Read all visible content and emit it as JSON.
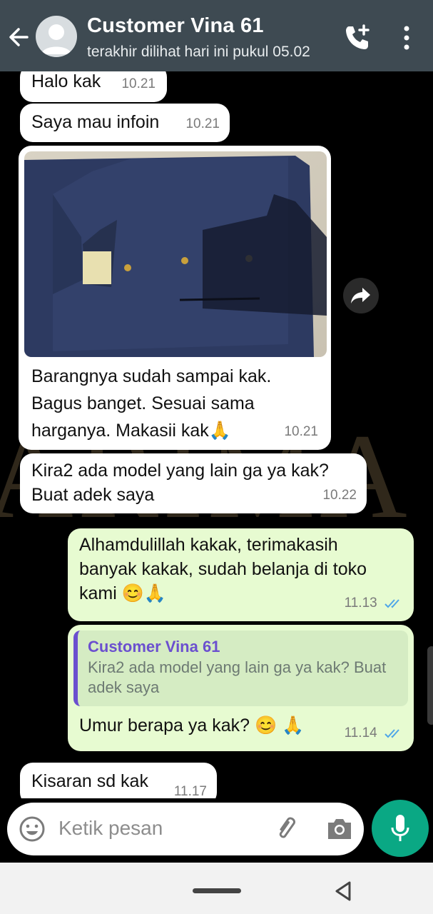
{
  "header": {
    "contact_name": "Customer Vina 61",
    "last_seen": "terakhir dilihat hari ini pukul 05.02"
  },
  "messages": [
    {
      "direction": "in",
      "text": "Halo kak",
      "time": "10.21"
    },
    {
      "direction": "in",
      "text": "Saya mau infoin",
      "time": "10.21"
    },
    {
      "direction": "in",
      "type": "image",
      "caption_lines": [
        "Barangnya sudah sampai kak.",
        "Bagus banget. Sesuai sama",
        "harganya. Makasii kak🙏"
      ],
      "time": "10.21"
    },
    {
      "direction": "in",
      "text_lines": [
        "Kira2 ada model yang lain ga ya kak?",
        "Buat adek saya"
      ],
      "time": "10.22"
    },
    {
      "direction": "out",
      "text_lines": [
        "Alhamdulillah kakak, terimakasih",
        "banyak kakak, sudah belanja di toko",
        "kami 😊🙏"
      ],
      "time": "11.13",
      "status": "read"
    },
    {
      "direction": "out",
      "reply_to": {
        "name": "Customer Vina 61",
        "text_lines": [
          "Kira2 ada model yang lain ga ya kak? Buat",
          "adek saya"
        ]
      },
      "text": "Umur berapa ya kak? 😊 🙏",
      "time": "11.14",
      "status": "read"
    },
    {
      "direction": "in",
      "text": "Kisaran sd kak",
      "time": "11.17"
    }
  ],
  "input": {
    "placeholder": "Ketik pesan"
  },
  "icons": {
    "back": "arrow-left-icon",
    "avatar": "default-avatar-icon",
    "call": "add-call-icon",
    "menu": "more-vert-icon",
    "forward": "forward-icon",
    "emoji": "emoji-icon",
    "attach": "paperclip-icon",
    "camera": "camera-icon",
    "mic": "microphone-icon",
    "read": "double-check-icon"
  },
  "colors": {
    "header": "#3e4a52",
    "outgoing_bubble": "#e7fbd1",
    "incoming_bubble": "#ffffff",
    "accent": "#0aa884",
    "read_ticks": "#4fa6e8",
    "quote_name": "#6b4fcf"
  }
}
